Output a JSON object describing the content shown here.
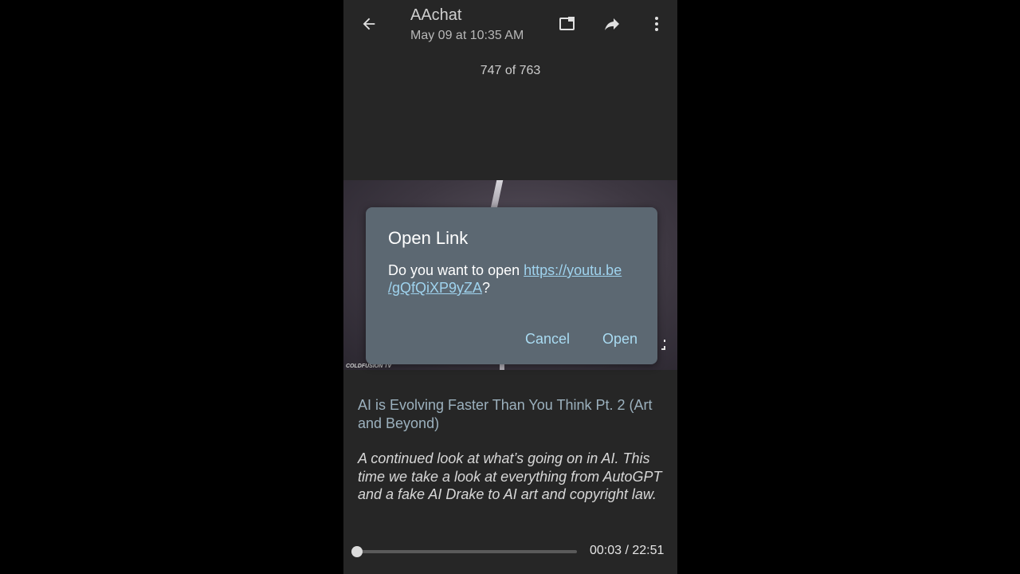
{
  "header": {
    "title": "AAchat",
    "subtitle": "May 09 at 10:35 AM",
    "icons": [
      "back-arrow-icon",
      "picture-in-picture-icon",
      "share-icon",
      "more-vert-icon"
    ]
  },
  "counter": "747 of 763",
  "media": {
    "watermark": "COLDFUSION TV"
  },
  "dialog": {
    "title": "Open Link",
    "body_prefix": "Do you want to open ",
    "link_line1": "https://youtu.be",
    "link_line2": "/gQfQiXP9yZA",
    "body_suffix": "?",
    "cancel_label": "Cancel",
    "open_label": "Open"
  },
  "description": {
    "headline": "AI is Evolving Faster Than You Think Pt. 2 (Art and Beyond)",
    "text": "A continued look at what’s going on in AI. This time we take a look at everything from AutoGPT and a fake AI Drake to AI art and copyright law."
  },
  "player": {
    "time": "00:03 / 22:51",
    "progress_fraction": 0.002
  },
  "colors": {
    "background": "#000000",
    "screen": "#262626",
    "dialog": "#5c6872",
    "link": "#9fd3ee",
    "headline": "#9cb1be"
  }
}
